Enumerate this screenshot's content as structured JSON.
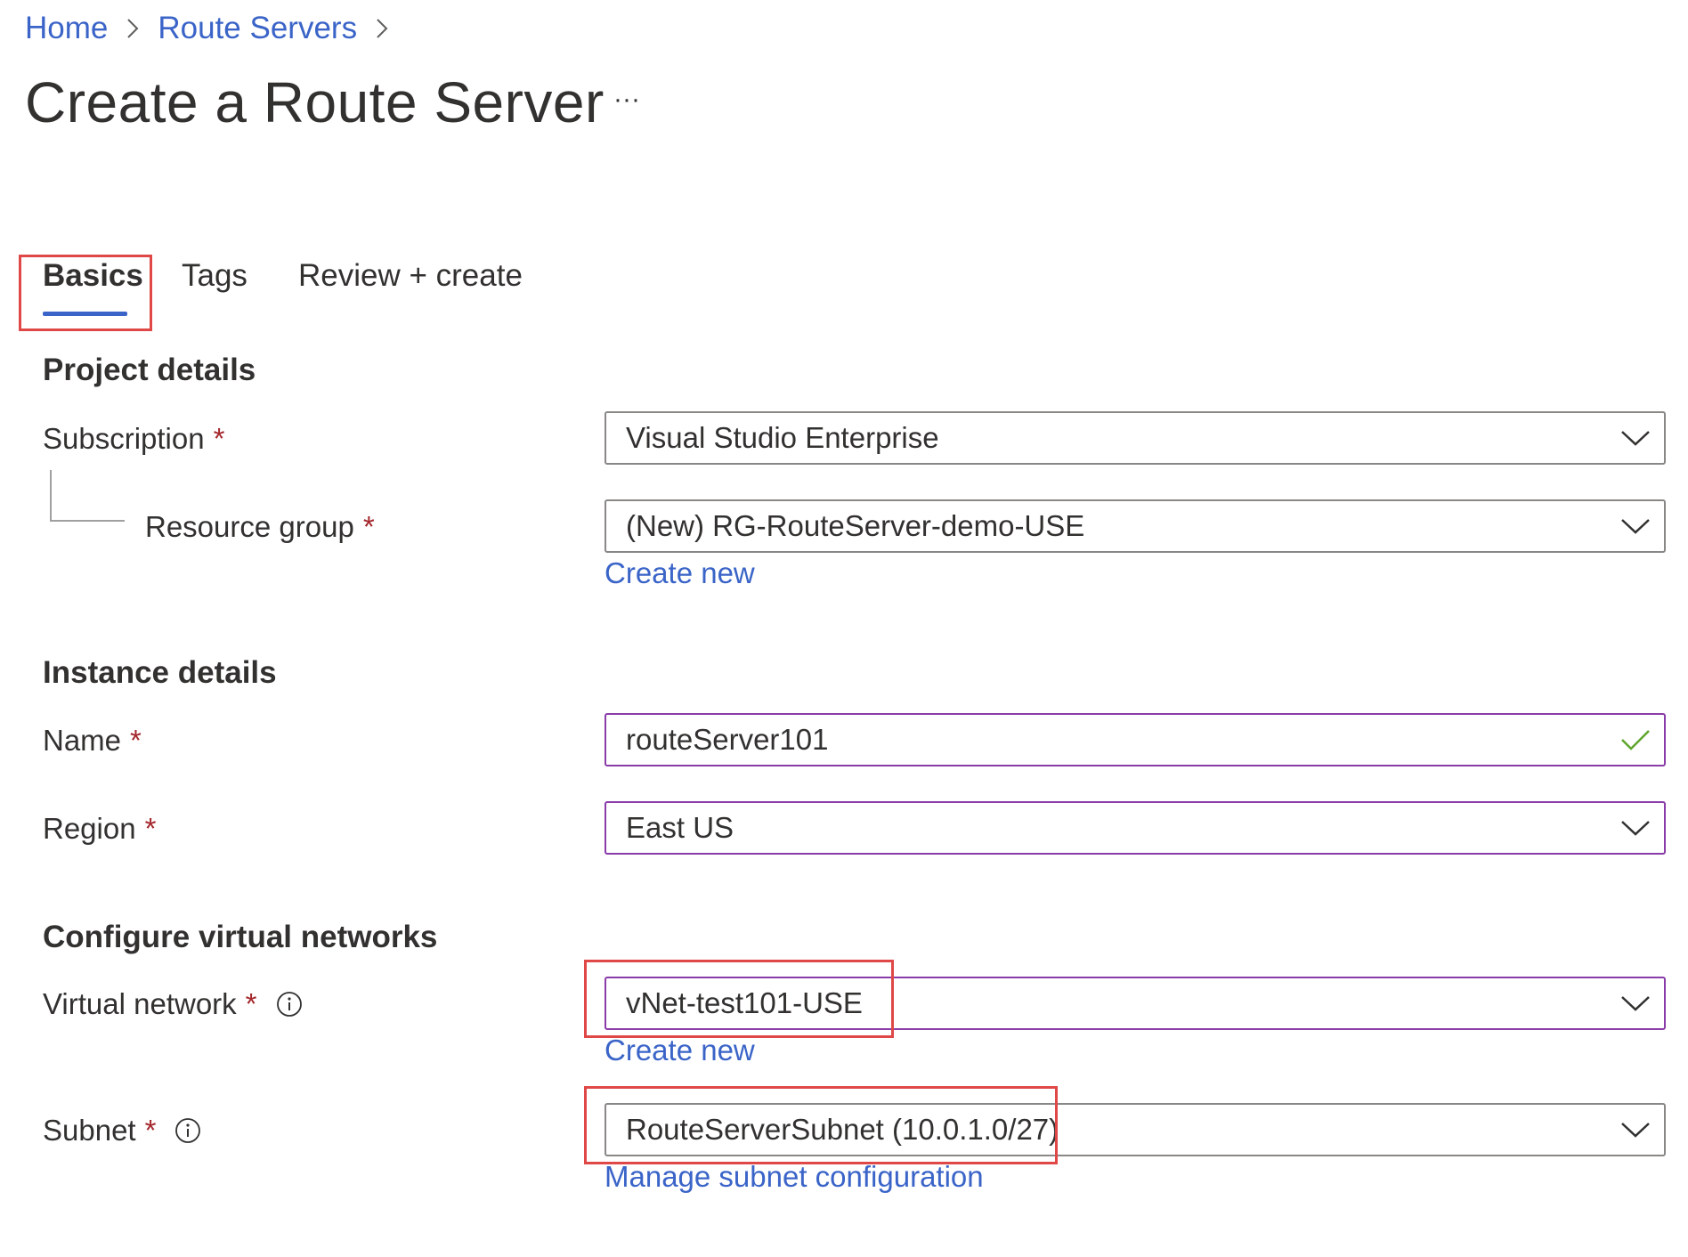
{
  "breadcrumb": {
    "home": "Home",
    "route_servers": "Route Servers"
  },
  "page": {
    "title": "Create a Route Server",
    "more": "···"
  },
  "tabs": [
    {
      "label": "Basics",
      "selected": true
    },
    {
      "label": "Tags",
      "selected": false
    },
    {
      "label": "Review + create",
      "selected": false
    }
  ],
  "project_details": {
    "heading": "Project details",
    "subscription": {
      "label": "Subscription",
      "value": "Visual Studio Enterprise"
    },
    "resource_group": {
      "label": "Resource group",
      "value": "(New) RG-RouteServer-demo-USE",
      "create_new": "Create new"
    }
  },
  "instance_details": {
    "heading": "Instance details",
    "name": {
      "label": "Name",
      "value": "routeServer101"
    },
    "region": {
      "label": "Region",
      "value": "East US"
    }
  },
  "virtual_networks": {
    "heading": "Configure virtual networks",
    "virtual_network": {
      "label": "Virtual network",
      "value": "vNet-test101-USE",
      "create_new": "Create new"
    },
    "subnet": {
      "label": "Subnet",
      "value": "RouteServerSubnet (10.0.1.0/27)",
      "manage": "Manage subnet configuration"
    }
  },
  "required_marker": "*",
  "colors": {
    "link": "#3a64c8",
    "required": "#a4262c",
    "highlight": "#e04848",
    "focus_border": "#8a3ca8",
    "valid_check": "#5ea52c"
  },
  "icons": {
    "chevron": "chevron-right-icon",
    "dropdown": "chevron-down-icon",
    "valid": "checkmark-icon",
    "info": "info-icon"
  }
}
